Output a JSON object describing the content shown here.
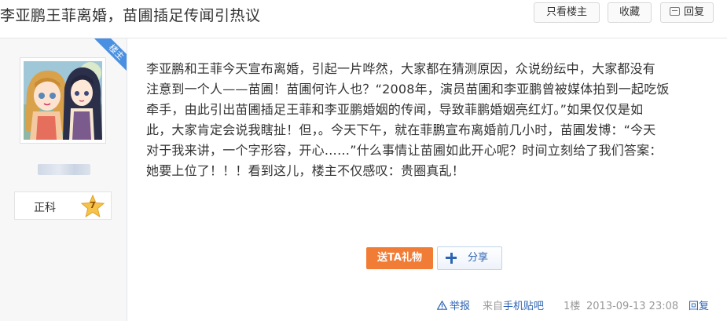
{
  "thread": {
    "title": "李亚鹏王菲离婚，苗圃插足传闻引热议",
    "buttons": {
      "only_author": "只看楼主",
      "favorite": "收藏",
      "reply": "回复"
    }
  },
  "author": {
    "badge": "楼主",
    "level_name": "正科",
    "level": "7"
  },
  "post": {
    "lines": [
      "李亚鹏和王菲今天宣布离婚，引起一片哗然，大家都在猜测原因，众说纷纭中，大家都没有",
      "注意到一个人——苗圃！苗圃何许人也？“2008年，演员苗圃和李亚鹏曾被媒体拍到一起吃饭",
      "牵手，由此引出苗圃插足王菲和李亚鹏婚姻的传闻，导致菲鹏婚姻亮红灯。”如果仅仅是如",
      "此，大家肯定会说我瞎扯！但，。今天下午，就在菲鹏宣布离婚前几小时，苗圃发博：“今天",
      "对于我来讲，一个字形容，开心……”什么事情让苗圃如此开心呢？时间立刻给了我们答案：",
      "她要上位了！！！看到这儿，楼主不仅感叹：贵圈真乱！"
    ],
    "gift_button": "送TA礼物",
    "share_button": "分享"
  },
  "footer": {
    "report": "举报",
    "from_prefix": "来自",
    "from_app": "手机贴吧",
    "floor": "1楼",
    "time": "2013-09-13 23:08",
    "reply": "回复"
  },
  "colors": {
    "link": "#2d64b3",
    "gift": "#f17c35",
    "badge": "#4a90e2"
  }
}
